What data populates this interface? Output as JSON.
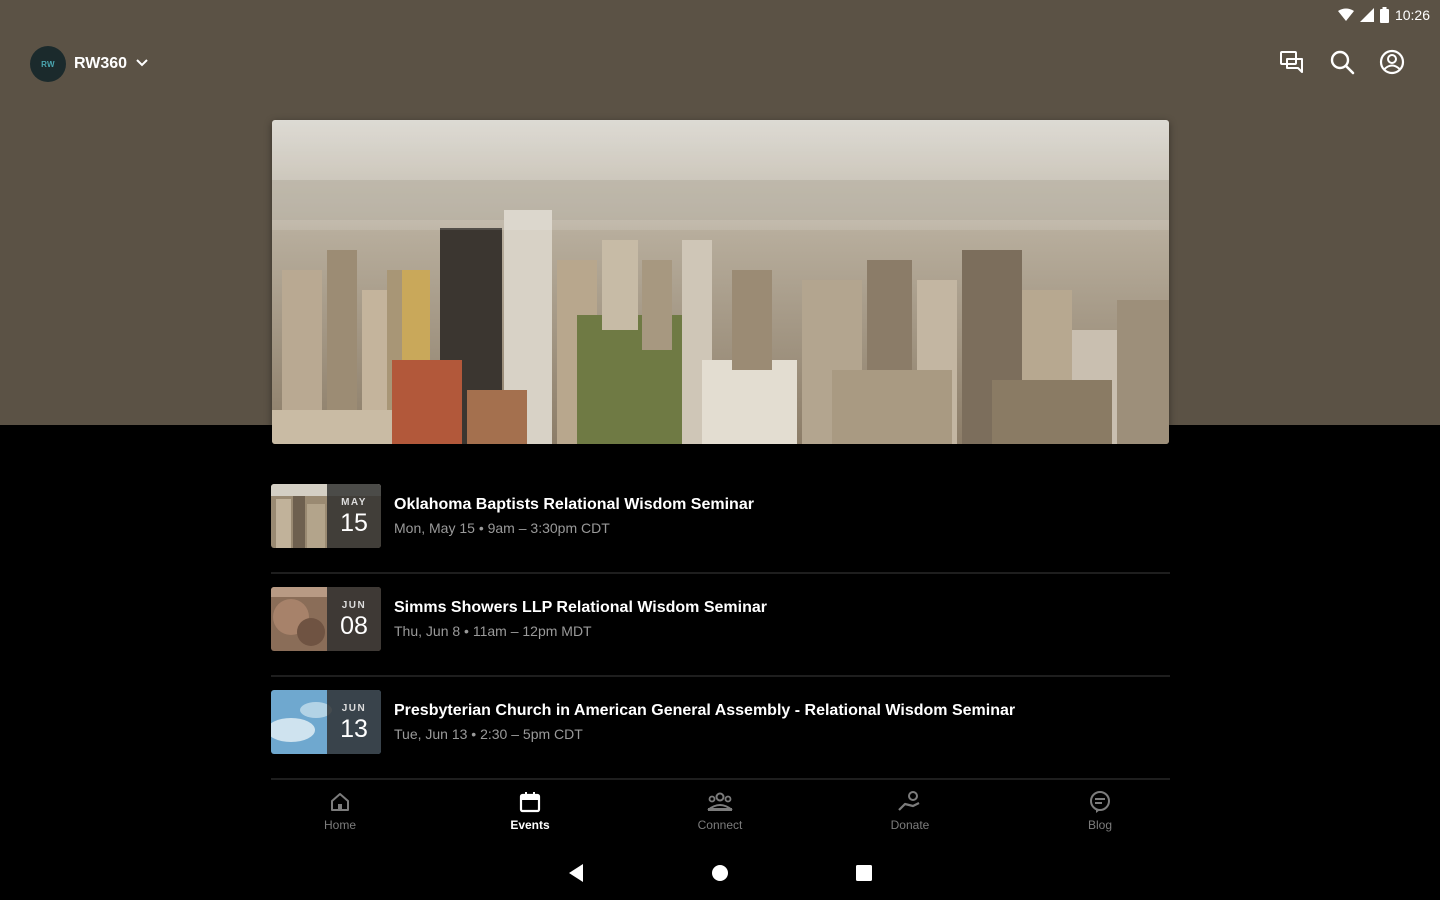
{
  "status": {
    "time": "10:26"
  },
  "header": {
    "org_logo_text": "RW",
    "org_name": "RW360"
  },
  "events": [
    {
      "month": "MAY",
      "day": "15",
      "title": "Oklahoma Baptists Relational Wisdom Seminar",
      "time": "Mon, May 15 • 9am – 3:30pm CDT"
    },
    {
      "month": "JUN",
      "day": "08",
      "title": "Simms Showers LLP Relational Wisdom Seminar",
      "time": "Thu, Jun 8 • 11am – 12pm MDT"
    },
    {
      "month": "JUN",
      "day": "13",
      "title": "Presbyterian Church in American General Assembly - Relational Wisdom Seminar",
      "time": "Tue, Jun 13 • 2:30 – 5pm CDT"
    }
  ],
  "nav": {
    "home": "Home",
    "events": "Events",
    "connect": "Connect",
    "donate": "Donate",
    "blog": "Blog",
    "active": "events"
  },
  "colors": {
    "header_bg": "#5b5245",
    "page_bg": "#000000"
  }
}
